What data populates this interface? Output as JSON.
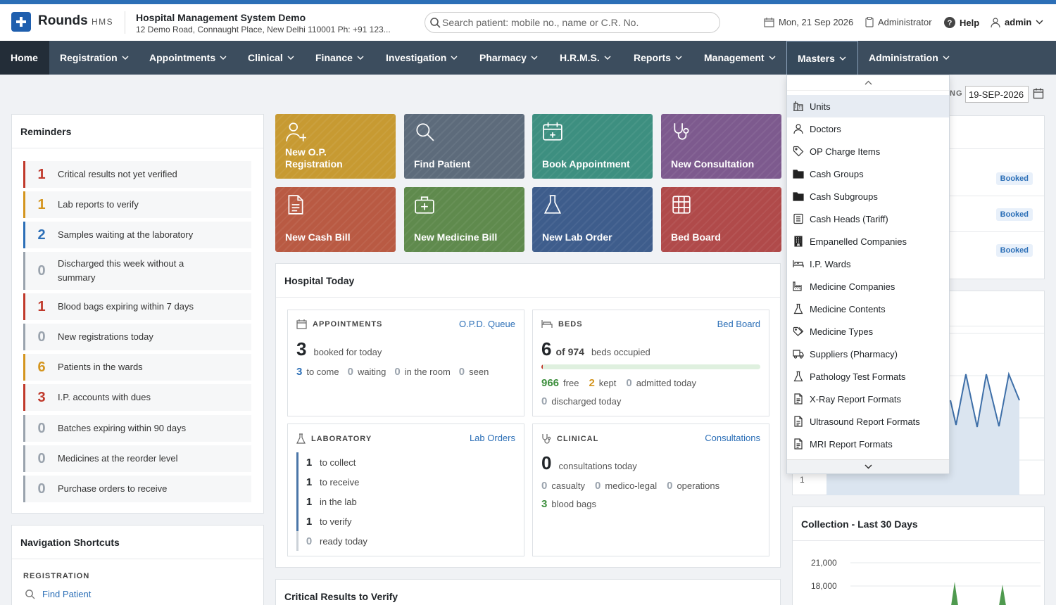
{
  "app": {
    "name": "Rounds",
    "suffix": "HMS"
  },
  "hospital": {
    "name": "Hospital Management System Demo",
    "address": "12 Demo Road, Connaught Place, New Delhi 110001 Ph: +91 123..."
  },
  "search": {
    "placeholder": "Search patient: mobile no., name or C.R. No."
  },
  "header": {
    "date": "Mon, 21 Sep 2026",
    "role": "Administrator",
    "help": "Help",
    "user": "admin"
  },
  "nav": {
    "items": [
      "Home",
      "Registration",
      "Appointments",
      "Clinical",
      "Finance",
      "Investigation",
      "Pharmacy",
      "H.R.M.S.",
      "Reports",
      "Management",
      "Masters",
      "Administration"
    ]
  },
  "date_filter": {
    "label_fragment": "NG",
    "value": "19-SEP-2026"
  },
  "reminders": {
    "title": "Reminders",
    "items": [
      {
        "count": "1",
        "text": "Critical results not yet verified",
        "color": "#c0392b"
      },
      {
        "count": "1",
        "text": "Lab reports to verify",
        "color": "#d4951e"
      },
      {
        "count": "2",
        "text": "Samples waiting at the laboratory",
        "color": "#2c6fb7"
      },
      {
        "count": "0",
        "text": "Discharged this week without a summary",
        "color": "#9aa3ad"
      },
      {
        "count": "1",
        "text": "Blood bags expiring within 7 days",
        "color": "#c0392b"
      },
      {
        "count": "0",
        "text": "New registrations today",
        "color": "#9aa3ad"
      },
      {
        "count": "6",
        "text": "Patients in the wards",
        "color": "#d4951e"
      },
      {
        "count": "3",
        "text": "I.P. accounts with dues",
        "color": "#c0392b"
      },
      {
        "count": "0",
        "text": "Batches expiring within 90 days",
        "color": "#9aa3ad"
      },
      {
        "count": "0",
        "text": "Medicines at the reorder level",
        "color": "#9aa3ad"
      },
      {
        "count": "0",
        "text": "Purchase orders to receive",
        "color": "#9aa3ad"
      }
    ]
  },
  "shortcuts": {
    "title": "Navigation Shortcuts",
    "section": "REGISTRATION",
    "link": "Find Patient"
  },
  "tiles": [
    {
      "label1": "New O.P.",
      "label2": "Registration",
      "color": "#c79a32",
      "icon": "user-plus-icon"
    },
    {
      "label1": "",
      "label2": "Find Patient",
      "color": "#5d6b7b",
      "icon": "search-icon"
    },
    {
      "label1": "",
      "label2": "Book Appointment",
      "color": "#3d8f80",
      "icon": "calendar-plus-icon"
    },
    {
      "label1": "",
      "label2": "New Consultation",
      "color": "#7d5a8e",
      "icon": "stethoscope-icon"
    },
    {
      "label1": "",
      "label2": "New Cash Bill",
      "color": "#b95a43",
      "icon": "document-icon"
    },
    {
      "label1": "",
      "label2": "New Medicine Bill",
      "color": "#5f8a4d",
      "icon": "medical-bag-icon"
    },
    {
      "label1": "",
      "label2": "New Lab Order",
      "color": "#3e5d8c",
      "icon": "flask-icon"
    },
    {
      "label1": "",
      "label2": "Bed Board",
      "color": "#b04a4a",
      "icon": "grid-icon"
    }
  ],
  "hospital_today": {
    "title": "Hospital Today",
    "appointments": {
      "title": "APPOINTMENTS",
      "link": "O.P.D. Queue",
      "booked": "3",
      "booked_label": "booked for today",
      "stats": [
        {
          "n": "3",
          "l": "to come"
        },
        {
          "n": "0",
          "l": "waiting"
        },
        {
          "n": "0",
          "l": "in the room"
        },
        {
          "n": "0",
          "l": "seen"
        }
      ]
    },
    "beds": {
      "title": "BEDS",
      "link": "Bed Board",
      "occupied": "6",
      "of_total": "of 974",
      "label": "beds occupied",
      "occupied_fraction": 0.006,
      "free": "966",
      "free_label": "free",
      "kept": "2",
      "kept_label": "kept",
      "admitted": "0",
      "admitted_label": "admitted today",
      "discharged": "0",
      "discharged_label": "discharged today"
    },
    "laboratory": {
      "title": "LABORATORY",
      "link": "Lab Orders",
      "rows": [
        {
          "n": "1",
          "l": "to collect"
        },
        {
          "n": "1",
          "l": "to receive"
        },
        {
          "n": "1",
          "l": "in the lab"
        },
        {
          "n": "1",
          "l": "to verify"
        },
        {
          "n": "0",
          "l": "ready today"
        }
      ]
    },
    "clinical": {
      "title": "CLINICAL",
      "link": "Consultations",
      "count": "0",
      "count_label": "consultations today",
      "casualty": "0",
      "casualty_label": "casualty",
      "mlc": "0",
      "mlc_label": "medico-legal",
      "ops": "0",
      "ops_label": "operations",
      "blood": "3",
      "blood_label": "blood bags"
    }
  },
  "critical": {
    "title": "Critical Results to Verify"
  },
  "right": {
    "badges": [
      "Booked",
      "Booked",
      "Booked"
    ],
    "chart_tick": "1"
  },
  "collection": {
    "title": "Collection - Last 30 Days",
    "ticks": [
      "21,000",
      "18,000"
    ]
  },
  "masters_menu": {
    "items": [
      {
        "label": "Units",
        "icon": "building-icon"
      },
      {
        "label": "Doctors",
        "icon": "user-icon"
      },
      {
        "label": "OP Charge Items",
        "icon": "tag-icon"
      },
      {
        "label": "Cash Groups",
        "icon": "folder-icon"
      },
      {
        "label": "Cash Subgroups",
        "icon": "folder-icon"
      },
      {
        "label": "Cash Heads (Tariff)",
        "icon": "list-icon"
      },
      {
        "label": "Empanelled Companies",
        "icon": "office-icon"
      },
      {
        "label": "I.P. Wards",
        "icon": "bed-icon"
      },
      {
        "label": "Medicine Companies",
        "icon": "factory-icon"
      },
      {
        "label": "Medicine Contents",
        "icon": "flask-icon"
      },
      {
        "label": "Medicine Types",
        "icon": "tags-icon"
      },
      {
        "label": "Suppliers (Pharmacy)",
        "icon": "truck-icon"
      },
      {
        "label": "Pathology Test Formats",
        "icon": "flask-icon"
      },
      {
        "label": "X-Ray Report Formats",
        "icon": "document-icon"
      },
      {
        "label": "Ultrasound Report Formats",
        "icon": "document-icon"
      },
      {
        "label": "MRI Report Formats",
        "icon": "document-icon"
      }
    ]
  }
}
